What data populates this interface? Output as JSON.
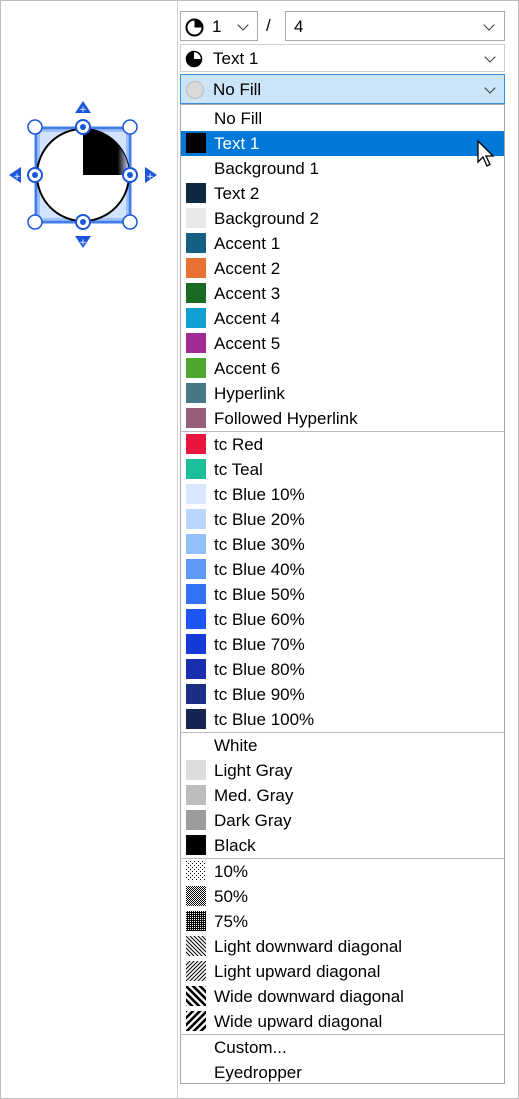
{
  "toolbar": {
    "numerator": "1",
    "slash": "/",
    "denominator": "4",
    "line_color": "Text 1",
    "fill_color": "No Fill"
  },
  "menu": {
    "items": [
      {
        "label": "No Fill",
        "swatch": null
      },
      {
        "label": "Text 1",
        "swatch": "#000000",
        "selected": true
      },
      {
        "label": "Background 1",
        "swatch": "#ffffff"
      },
      {
        "label": "Text 2",
        "swatch": "#0e2841"
      },
      {
        "label": "Background 2",
        "swatch": "#e8e8e8"
      },
      {
        "label": "Accent 1",
        "swatch": "#156082"
      },
      {
        "label": "Accent 2",
        "swatch": "#e97132"
      },
      {
        "label": "Accent 3",
        "swatch": "#196b24"
      },
      {
        "label": "Accent 4",
        "swatch": "#0f9ed5"
      },
      {
        "label": "Accent 5",
        "swatch": "#a02b93"
      },
      {
        "label": "Accent 6",
        "swatch": "#4ea72e"
      },
      {
        "label": "Hyperlink",
        "swatch": "#467886"
      },
      {
        "label": "Followed Hyperlink",
        "swatch": "#96607d"
      },
      {
        "label": "tc Red",
        "swatch": "#e8163c"
      },
      {
        "label": "tc Teal",
        "swatch": "#1cbf99"
      },
      {
        "label": "tc Blue 10%",
        "swatch": "#d9e8ff"
      },
      {
        "label": "tc Blue 20%",
        "swatch": "#b9d7ff"
      },
      {
        "label": "tc Blue 30%",
        "swatch": "#93c0fd"
      },
      {
        "label": "tc Blue 40%",
        "swatch": "#5e9bf9"
      },
      {
        "label": "tc Blue 50%",
        "swatch": "#3371f6"
      },
      {
        "label": "tc Blue 60%",
        "swatch": "#1c55f2"
      },
      {
        "label": "tc Blue 70%",
        "swatch": "#1639d9"
      },
      {
        "label": "tc Blue 80%",
        "swatch": "#1a2fad"
      },
      {
        "label": "tc Blue 90%",
        "swatch": "#1c2f86"
      },
      {
        "label": "tc Blue 100%",
        "swatch": "#172350"
      },
      {
        "label": "White",
        "swatch": "#ffffff"
      },
      {
        "label": "Light Gray",
        "swatch": "#dcdcdc"
      },
      {
        "label": "Med. Gray",
        "swatch": "#bdbdbd"
      },
      {
        "label": "Dark Gray",
        "swatch": "#9c9c9c"
      },
      {
        "label": "Black",
        "swatch": "#000000"
      },
      {
        "label": "10%",
        "pattern": "p10"
      },
      {
        "label": "50%",
        "pattern": "p50"
      },
      {
        "label": "75%",
        "pattern": "p75"
      },
      {
        "label": "Light downward diagonal",
        "pattern": "ldd"
      },
      {
        "label": "Light upward diagonal",
        "pattern": "lud"
      },
      {
        "label": "Wide downward diagonal",
        "pattern": "wdd"
      },
      {
        "label": "Wide upward diagonal",
        "pattern": "wud"
      },
      {
        "label": "Custom...",
        "swatch": null
      },
      {
        "label": "Eyedropper",
        "swatch": null
      }
    ]
  },
  "colors": {
    "selection": "#0078d7",
    "handle": "#1a56db",
    "fill_combo_bg": "#cce4f7"
  }
}
